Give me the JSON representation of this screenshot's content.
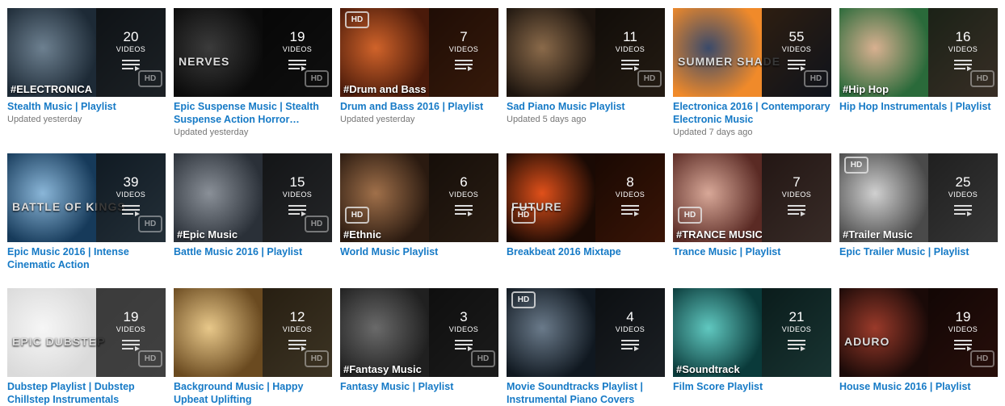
{
  "video_label": "VIDEOS",
  "hd_label": "HD",
  "rows": [
    [
      {
        "title": "Stealth Music | Playlist",
        "count": "20",
        "updated": "Updated yesterday",
        "caption": "#ELECTRONICA",
        "art": "dark",
        "hd": "right"
      },
      {
        "title": "Epic Suspense Music | Stealth Suspense Action Horror…",
        "count": "19",
        "updated": "Updated yesterday",
        "overtitle": "NERVES",
        "art": "mono",
        "hd": "right"
      },
      {
        "title": "Drum and Bass 2016 | Playlist",
        "count": "7",
        "updated": "Updated yesterday",
        "caption": "#Drum and Bass",
        "art": "warm",
        "hd": "left-top"
      },
      {
        "title": "Sad Piano Music Playlist",
        "count": "11",
        "updated": "Updated 5 days ago",
        "art": "bronze",
        "hd": "right"
      },
      {
        "title": "Electronica 2016 | Contemporary Electronic Music",
        "count": "55",
        "updated": "Updated 7 days ago",
        "overtitle": "SUMMER SHADE",
        "art": "sunset",
        "hd": "right"
      },
      {
        "title": "Hip Hop Instrumentals | Playlist",
        "count": "16",
        "caption": "#Hip Hop",
        "art": "face",
        "hd": "right"
      }
    ],
    [
      {
        "title": "Epic Music 2016 | Intense Cinematic Action",
        "count": "39",
        "overtitle": "BATTLE OF KINGS",
        "art": "blue",
        "hd": "right"
      },
      {
        "title": "Battle Music 2016 | Playlist",
        "count": "15",
        "caption": "#Epic Music",
        "art": "steel",
        "hd": "right"
      },
      {
        "title": "World Music Playlist",
        "count": "6",
        "caption": "#Ethnic",
        "art": "earth",
        "hd": "left-mid"
      },
      {
        "title": "Breakbeat 2016 Mixtape",
        "count": "8",
        "overtitle": "FUTURE",
        "art": "fire",
        "hd": "left-mid"
      },
      {
        "title": "Trance Music | Playlist",
        "count": "7",
        "caption": "#TRANCE MUSIC",
        "art": "rose",
        "hd": "left-mid"
      },
      {
        "title": "Epic Trailer Music | Playlist",
        "count": "25",
        "caption": "#Trailer Music",
        "art": "chrome",
        "hd": "left-top"
      }
    ],
    [
      {
        "title": "Dubstep Playlist | Dubstep Chillstep Instrumentals",
        "count": "19",
        "overtitle": "EPIC DUBSTEP",
        "art": "white",
        "hd": "right"
      },
      {
        "title": "Background Music | Happy Upbeat Uplifting",
        "count": "12",
        "art": "golden",
        "hd": "right"
      },
      {
        "title": "Fantasy Music | Playlist",
        "count": "3",
        "caption": "#Fantasy Music",
        "art": "grey",
        "hd": "right"
      },
      {
        "title": "Movie Soundtracks Playlist | Instrumental Piano Covers",
        "count": "4",
        "art": "cyborg",
        "hd": "left-top"
      },
      {
        "title": "Film Score Playlist",
        "count": "21",
        "caption": "#Soundtrack",
        "art": "teal",
        "hd": "none"
      },
      {
        "title": "House Music 2016 | Playlist",
        "count": "19",
        "overtitle": "ADURO",
        "art": "vinyl",
        "hd": "right"
      }
    ]
  ],
  "art_colors": {
    "dark": [
      "#1d2a36",
      "#6d8090"
    ],
    "mono": [
      "#0b0b0b",
      "#3b3b3b"
    ],
    "warm": [
      "#4a1a0a",
      "#d0632a"
    ],
    "bronze": [
      "#1c140e",
      "#8a6a4a"
    ],
    "sunset": [
      "#f08a2a",
      "#3a4a6a"
    ],
    "face": [
      "#2a6a3a",
      "#d8b090"
    ],
    "blue": [
      "#163a5a",
      "#8ab6d8"
    ],
    "steel": [
      "#2a3038",
      "#8a9098"
    ],
    "earth": [
      "#2a1a10",
      "#a0704a"
    ],
    "fire": [
      "#1a0a04",
      "#e0501a"
    ],
    "rose": [
      "#5a2a24",
      "#d8a898"
    ],
    "chrome": [
      "#4a4a4a",
      "#d0d0d0"
    ],
    "white": [
      "#dadada",
      "#f6f6f6"
    ],
    "golden": [
      "#6a4a20",
      "#e8c88a"
    ],
    "grey": [
      "#202020",
      "#6a6a6a"
    ],
    "cyborg": [
      "#101820",
      "#6a7a8a"
    ],
    "teal": [
      "#0a3a3a",
      "#60c8c0"
    ],
    "vinyl": [
      "#1a0a08",
      "#9a3a2a"
    ]
  },
  "link_color": "#167ac6"
}
